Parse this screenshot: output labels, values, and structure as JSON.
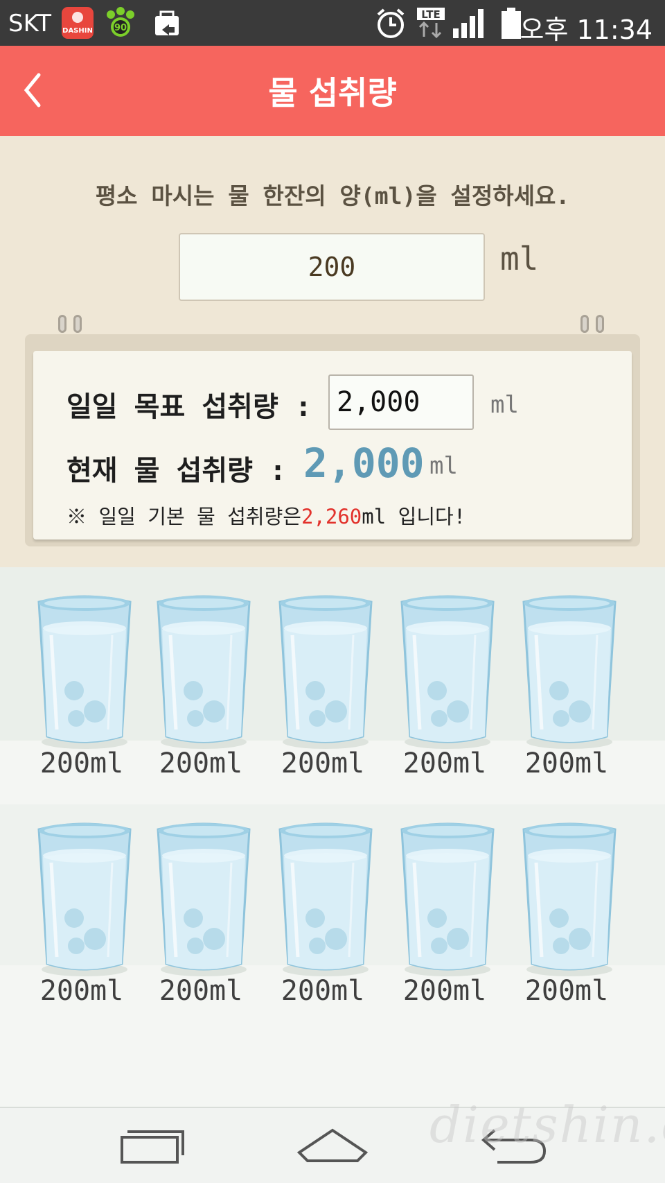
{
  "status_bar": {
    "carrier": "SKT",
    "app_icon_1": "DASHIN",
    "app_icon_2": "90",
    "network": "LTE",
    "time": "오후 11:34"
  },
  "header": {
    "title": "물 섭취량",
    "back_icon": "chevron-left-icon"
  },
  "setup": {
    "prompt": "평소 마시는 물 한잔의 양(ml)을 설정하세요.",
    "cup_amount": "200",
    "cup_unit": "ml"
  },
  "memo": {
    "goal_label": "일일 목표 섭취량 :",
    "goal_value": "2,000",
    "goal_unit": "ml",
    "current_label": "현재 물 섭취량 :",
    "current_value": "2,000",
    "current_unit": "ml",
    "note_prefix": "※ 일일 기본 물 섭취량은",
    "note_value": "2,260",
    "note_suffix": "ml 입니다!"
  },
  "glasses": [
    {
      "label": "200ml"
    },
    {
      "label": "200ml"
    },
    {
      "label": "200ml"
    },
    {
      "label": "200ml"
    },
    {
      "label": "200ml"
    },
    {
      "label": "200ml"
    },
    {
      "label": "200ml"
    },
    {
      "label": "200ml"
    },
    {
      "label": "200ml"
    },
    {
      "label": "200ml"
    }
  ],
  "nav": {
    "recent_icon": "recent-apps-icon",
    "home_icon": "home-icon",
    "back_icon": "back-arrow-icon"
  },
  "watermark": "dietshin.com",
  "colors": {
    "header": "#f6655e",
    "setup_bg": "#efe7d6",
    "current_value": "#5f9ab5",
    "note_highlight": "#e2322c"
  }
}
